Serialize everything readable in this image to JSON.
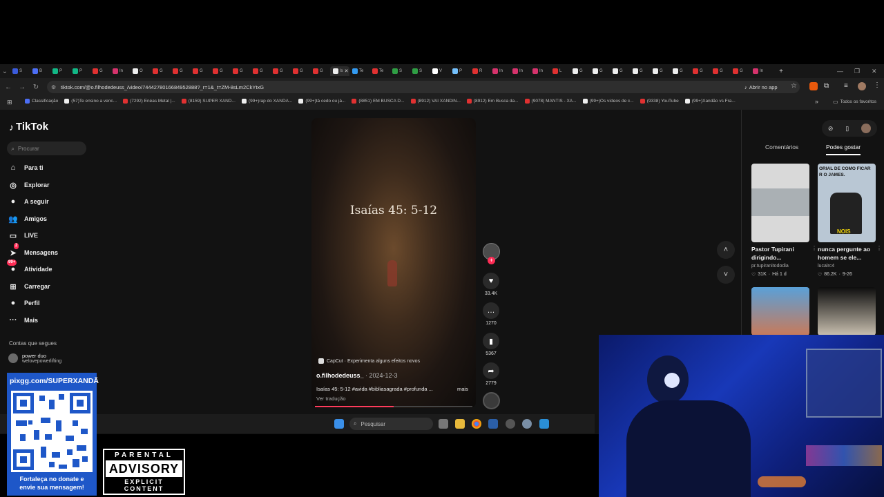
{
  "browser": {
    "tabs": [
      {
        "letter": "S",
        "color": "#3b5bdb"
      },
      {
        "letter": "B",
        "color": "#4c6ef5"
      },
      {
        "letter": "P",
        "color": "#12b886"
      },
      {
        "letter": "P",
        "color": "#12b886"
      },
      {
        "letter": "G",
        "color": "#e03131"
      },
      {
        "letter": "In",
        "color": "#d6336c"
      },
      {
        "letter": "O",
        "color": "#eeeeee"
      },
      {
        "letter": "G",
        "color": "#e03131"
      },
      {
        "letter": "G",
        "color": "#e03131"
      },
      {
        "letter": "G",
        "color": "#e03131"
      },
      {
        "letter": "G",
        "color": "#e03131"
      },
      {
        "letter": "G",
        "color": "#e03131"
      },
      {
        "letter": "G",
        "color": "#e03131"
      },
      {
        "letter": "G",
        "color": "#e03131"
      },
      {
        "letter": "G",
        "color": "#e03131"
      },
      {
        "letter": "G",
        "color": "#e03131"
      },
      {
        "letter": "Is",
        "color": "#eeeeee",
        "active": true
      },
      {
        "letter": "Te",
        "color": "#339af0"
      },
      {
        "letter": "Te",
        "color": "#e03131"
      },
      {
        "letter": "S",
        "color": "#2f9e44"
      },
      {
        "letter": "S",
        "color": "#2f9e44"
      },
      {
        "letter": "V",
        "color": "#ffffff"
      },
      {
        "letter": "P",
        "color": "#74c0fc"
      },
      {
        "letter": "R",
        "color": "#e03131"
      },
      {
        "letter": "In",
        "color": "#d6336c"
      },
      {
        "letter": "In",
        "color": "#d6336c"
      },
      {
        "letter": "In",
        "color": "#d6336c"
      },
      {
        "letter": "L",
        "color": "#e03131"
      },
      {
        "letter": "G",
        "color": "#eeeeee"
      },
      {
        "letter": "G",
        "color": "#eeeeee"
      },
      {
        "letter": "G",
        "color": "#eeeeee"
      },
      {
        "letter": "G",
        "color": "#eeeeee"
      },
      {
        "letter": "G",
        "color": "#eeeeee"
      },
      {
        "letter": "G",
        "color": "#eeeeee"
      },
      {
        "letter": "G",
        "color": "#e03131"
      },
      {
        "letter": "G",
        "color": "#e03131"
      },
      {
        "letter": "G",
        "color": "#e03131"
      },
      {
        "letter": "In",
        "color": "#d6336c"
      }
    ],
    "new_tab": "+",
    "url": "tiktok.com/@o.filhodedeuss_/video/7444278016684952888?_r=1&_t=ZM-8sLm2CkYtxG",
    "open_app": "Abrir no app",
    "bookmarks": [
      {
        "label": "Classificação",
        "color": "#4c6ef5"
      },
      {
        "label": "(57)Te ensino a venc...",
        "color": "#eeeeee"
      },
      {
        "label": "(7292) Enéas Metal |...",
        "color": "#e03131"
      },
      {
        "label": "(8159) SUPER XAND...",
        "color": "#e03131"
      },
      {
        "label": "(99+)rap do XANDÃ...",
        "color": "#eeeeee"
      },
      {
        "label": "(99+)tá cedo ou já...",
        "color": "#eeeeee"
      },
      {
        "label": "(8851) EM BUSCA D...",
        "color": "#e03131"
      },
      {
        "label": "(8912) VAI XANDIN...",
        "color": "#e03131"
      },
      {
        "label": "(8912) Em Busca da...",
        "color": "#e03131"
      },
      {
        "label": "(9078) MANTIS - XA...",
        "color": "#e03131"
      },
      {
        "label": "(99+)Os vídeos de c...",
        "color": "#eeeeee"
      },
      {
        "label": "(9338) YouTube",
        "color": "#e03131"
      },
      {
        "label": "(99+)Xandão vs Fra...",
        "color": "#eeeeee"
      }
    ],
    "bookmarks_more": "»",
    "all_favorites": "Todos os favoritos"
  },
  "tiktok": {
    "logo": "TikTok",
    "search_placeholder": "Procurar",
    "nav": [
      {
        "label": "Para ti",
        "icon": "home-icon",
        "glyph": "⌂"
      },
      {
        "label": "Explorar",
        "icon": "compass-icon",
        "glyph": "◎"
      },
      {
        "label": "A seguir",
        "icon": "following-icon",
        "glyph": "●"
      },
      {
        "label": "Amigos",
        "icon": "friends-icon",
        "glyph": "👥"
      },
      {
        "label": "LIVE",
        "icon": "live-icon",
        "glyph": "▭"
      },
      {
        "label": "Mensagens",
        "icon": "messages-icon",
        "glyph": "➤",
        "badge": "2"
      },
      {
        "label": "Atividade",
        "icon": "activity-icon",
        "glyph": "●",
        "badge": "99+"
      },
      {
        "label": "Carregar",
        "icon": "upload-icon",
        "glyph": "⊞"
      },
      {
        "label": "Perfil",
        "icon": "profile-icon",
        "glyph": "●"
      },
      {
        "label": "Mais",
        "icon": "more-icon",
        "glyph": "···"
      }
    ],
    "following_title": "Contas que segues",
    "following": [
      {
        "name": "power duo",
        "handle": "welovepowerlifting"
      }
    ],
    "video": {
      "overlay_title": "Isaías 45: 5-12",
      "capcut": "CapCut · Experimenta alguns efeitos novos",
      "author": "o.filhodedeuss_",
      "date": " · 2024-12-3",
      "caption": "Isaías 45: 5-12    #avida #bibliasagrada #profunda ...",
      "more": "mais",
      "translate": "Ver tradução",
      "progress": 0.5
    },
    "actions": {
      "likes": "33.4K",
      "comments": "1270",
      "saves": "5367",
      "shares": "2779"
    },
    "right_panel": {
      "tab_comments": "Comentários",
      "tab_suggested": "Podes gostar",
      "videos": [
        {
          "title": "Pastor Tupirani dirigindo...",
          "user": "pr.tupiranitododia",
          "likes": "31K",
          "age": "Há 1 d",
          "thumb_text": ""
        },
        {
          "title": "nunca pergunte ao homem se ele...",
          "user": "lucalrc4",
          "likes": "86.2K",
          "age": "9-26",
          "thumb_text": "ORIAL DE COMO FICAR R O JAMES.",
          "thumb_label": "NOIS"
        },
        {
          "title": "",
          "user": "",
          "likes": "",
          "age": "",
          "thumb_text": ""
        },
        {
          "title": "",
          "user": "",
          "likes": "",
          "age": "",
          "thumb_text": ""
        }
      ]
    }
  },
  "taskbar": {
    "search_placeholder": "Pesquisar"
  },
  "stream_overlay": {
    "qr_url": "pixgg.com/SUPERXANDÃ",
    "qr_message_1": "Fortaleça no donate e",
    "qr_message_2": "envie sua mensagem!",
    "advisory_1": "PARENTAL",
    "advisory_2": "ADVISORY",
    "advisory_3": "EXPLICIT CONTENT"
  },
  "colors": {
    "tiktok_red": "#fe2c55",
    "pix_blue": "#1e57c8",
    "webcam_blue": "#1838b8"
  }
}
